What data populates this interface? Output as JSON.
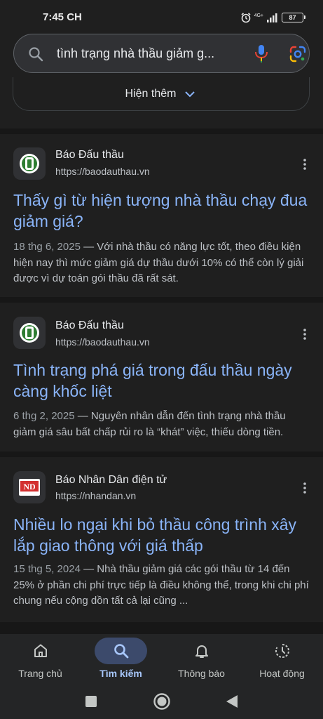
{
  "status_bar": {
    "time": "7:45 CH",
    "network": "4G+",
    "battery": "87"
  },
  "search": {
    "query": "tình trạng nhà thầu giảm g..."
  },
  "show_more": {
    "label": "Hiện thêm"
  },
  "results": [
    {
      "site_name": "Báo Đấu thầu",
      "url": "https://baodauthau.vn",
      "title": "Thấy gì từ hiện tượng nhà thầu chạy đua giảm giá?",
      "date": "18 thg 6, 2025",
      "snippet": "Với nhà thầu có năng lực tốt, theo điều kiện hiện nay thì mức giảm giá dự thầu dưới 10% có thể còn lý giải được vì dự toán gói thầu đã rất sát.",
      "favicon": "baodauthau-logo"
    },
    {
      "site_name": "Báo Đấu thầu",
      "url": "https://baodauthau.vn",
      "title": "Tình trạng phá giá trong đấu thầu ngày càng khốc liệt",
      "date": "6 thg 2, 2025",
      "snippet": "Nguyên nhân dẫn đến tình trạng nhà thầu giảm giá sâu bất chấp rủi ro là “khát” việc, thiếu dòng tiền.",
      "favicon": "baodauthau-logo"
    },
    {
      "site_name": "Báo Nhân Dân điện tử",
      "url": "https://nhandan.vn",
      "title": "Nhiều lo ngại khi bỏ thầu công trình xây lắp giao thông với giá thấp",
      "date": "15 thg 5, 2024",
      "snippet": "Nhà thầu giảm giá các gói thầu từ 14 đến 25% ở phần chi phí trực tiếp là điều không thể, trong khi chi phí chung nếu cộng dồn tất cả lại cũng ...",
      "favicon": "nhandan-logo",
      "favicon_text": "ND"
    }
  ],
  "bottom_nav": {
    "items": [
      {
        "label": "Trang chủ",
        "icon": "home-icon",
        "active": false
      },
      {
        "label": "Tìm kiếm",
        "icon": "search-icon",
        "active": true
      },
      {
        "label": "Thông báo",
        "icon": "bell-icon",
        "active": false
      },
      {
        "label": "Hoạt động",
        "icon": "history-icon",
        "active": false
      }
    ]
  },
  "colors": {
    "background": "#1f1f1f",
    "link": "#8ab4f8",
    "active_nav": "#a8c7fa",
    "mic_red": "#ea4335"
  }
}
